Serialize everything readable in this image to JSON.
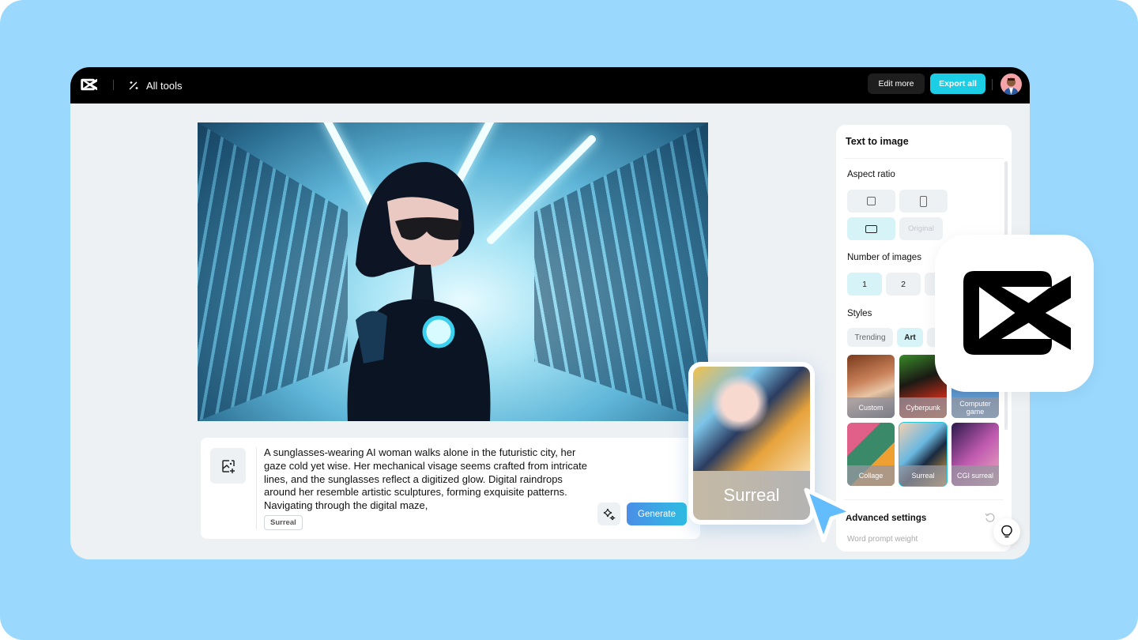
{
  "topbar": {
    "logo": "capcut-logo-icon",
    "all_tools_label": "All tools",
    "edit_more_label": "Edit more",
    "export_all_label": "Export all",
    "accent_color": "#1ccde6"
  },
  "prompt": {
    "text": "A sunglasses-wearing AI woman walks alone in the futuristic city, her gaze cold yet wise. Her mechanical visage seems crafted from intricate lines, and the sunglasses reflect a digitized glow. Digital raindrops around her resemble artistic sculptures, forming exquisite patterns. Navigating through the digital maze,",
    "style_tag": "Surreal",
    "generate_label": "Generate"
  },
  "panel": {
    "title": "Text to image",
    "aspect_ratio_label": "Aspect ratio",
    "aspect_options": [
      {
        "id": "square",
        "label": "",
        "active": false
      },
      {
        "id": "portrait",
        "label": "",
        "active": false
      },
      {
        "id": "landscape",
        "label": "",
        "active": true
      },
      {
        "id": "original",
        "label": "Original",
        "active": false,
        "disabled": true
      }
    ],
    "number_label": "Number of images",
    "number_options": [
      {
        "label": "1",
        "active": true
      },
      {
        "label": "2",
        "active": false
      }
    ],
    "styles_label": "Styles",
    "style_tabs": [
      {
        "label": "Trending",
        "active": false
      },
      {
        "label": "Art",
        "active": true
      }
    ],
    "styles": [
      {
        "label": "Custom",
        "selected": false
      },
      {
        "label": "Cyberpunk",
        "selected": false
      },
      {
        "label": "Computer game",
        "selected": false
      },
      {
        "label": "Collage",
        "selected": false
      },
      {
        "label": "Surreal",
        "selected": true
      },
      {
        "label": "CGI surreal",
        "selected": false
      }
    ],
    "advanced_label": "Advanced settings",
    "hint_text": "Word prompt weight"
  },
  "float_card": {
    "label": "Surreal"
  }
}
